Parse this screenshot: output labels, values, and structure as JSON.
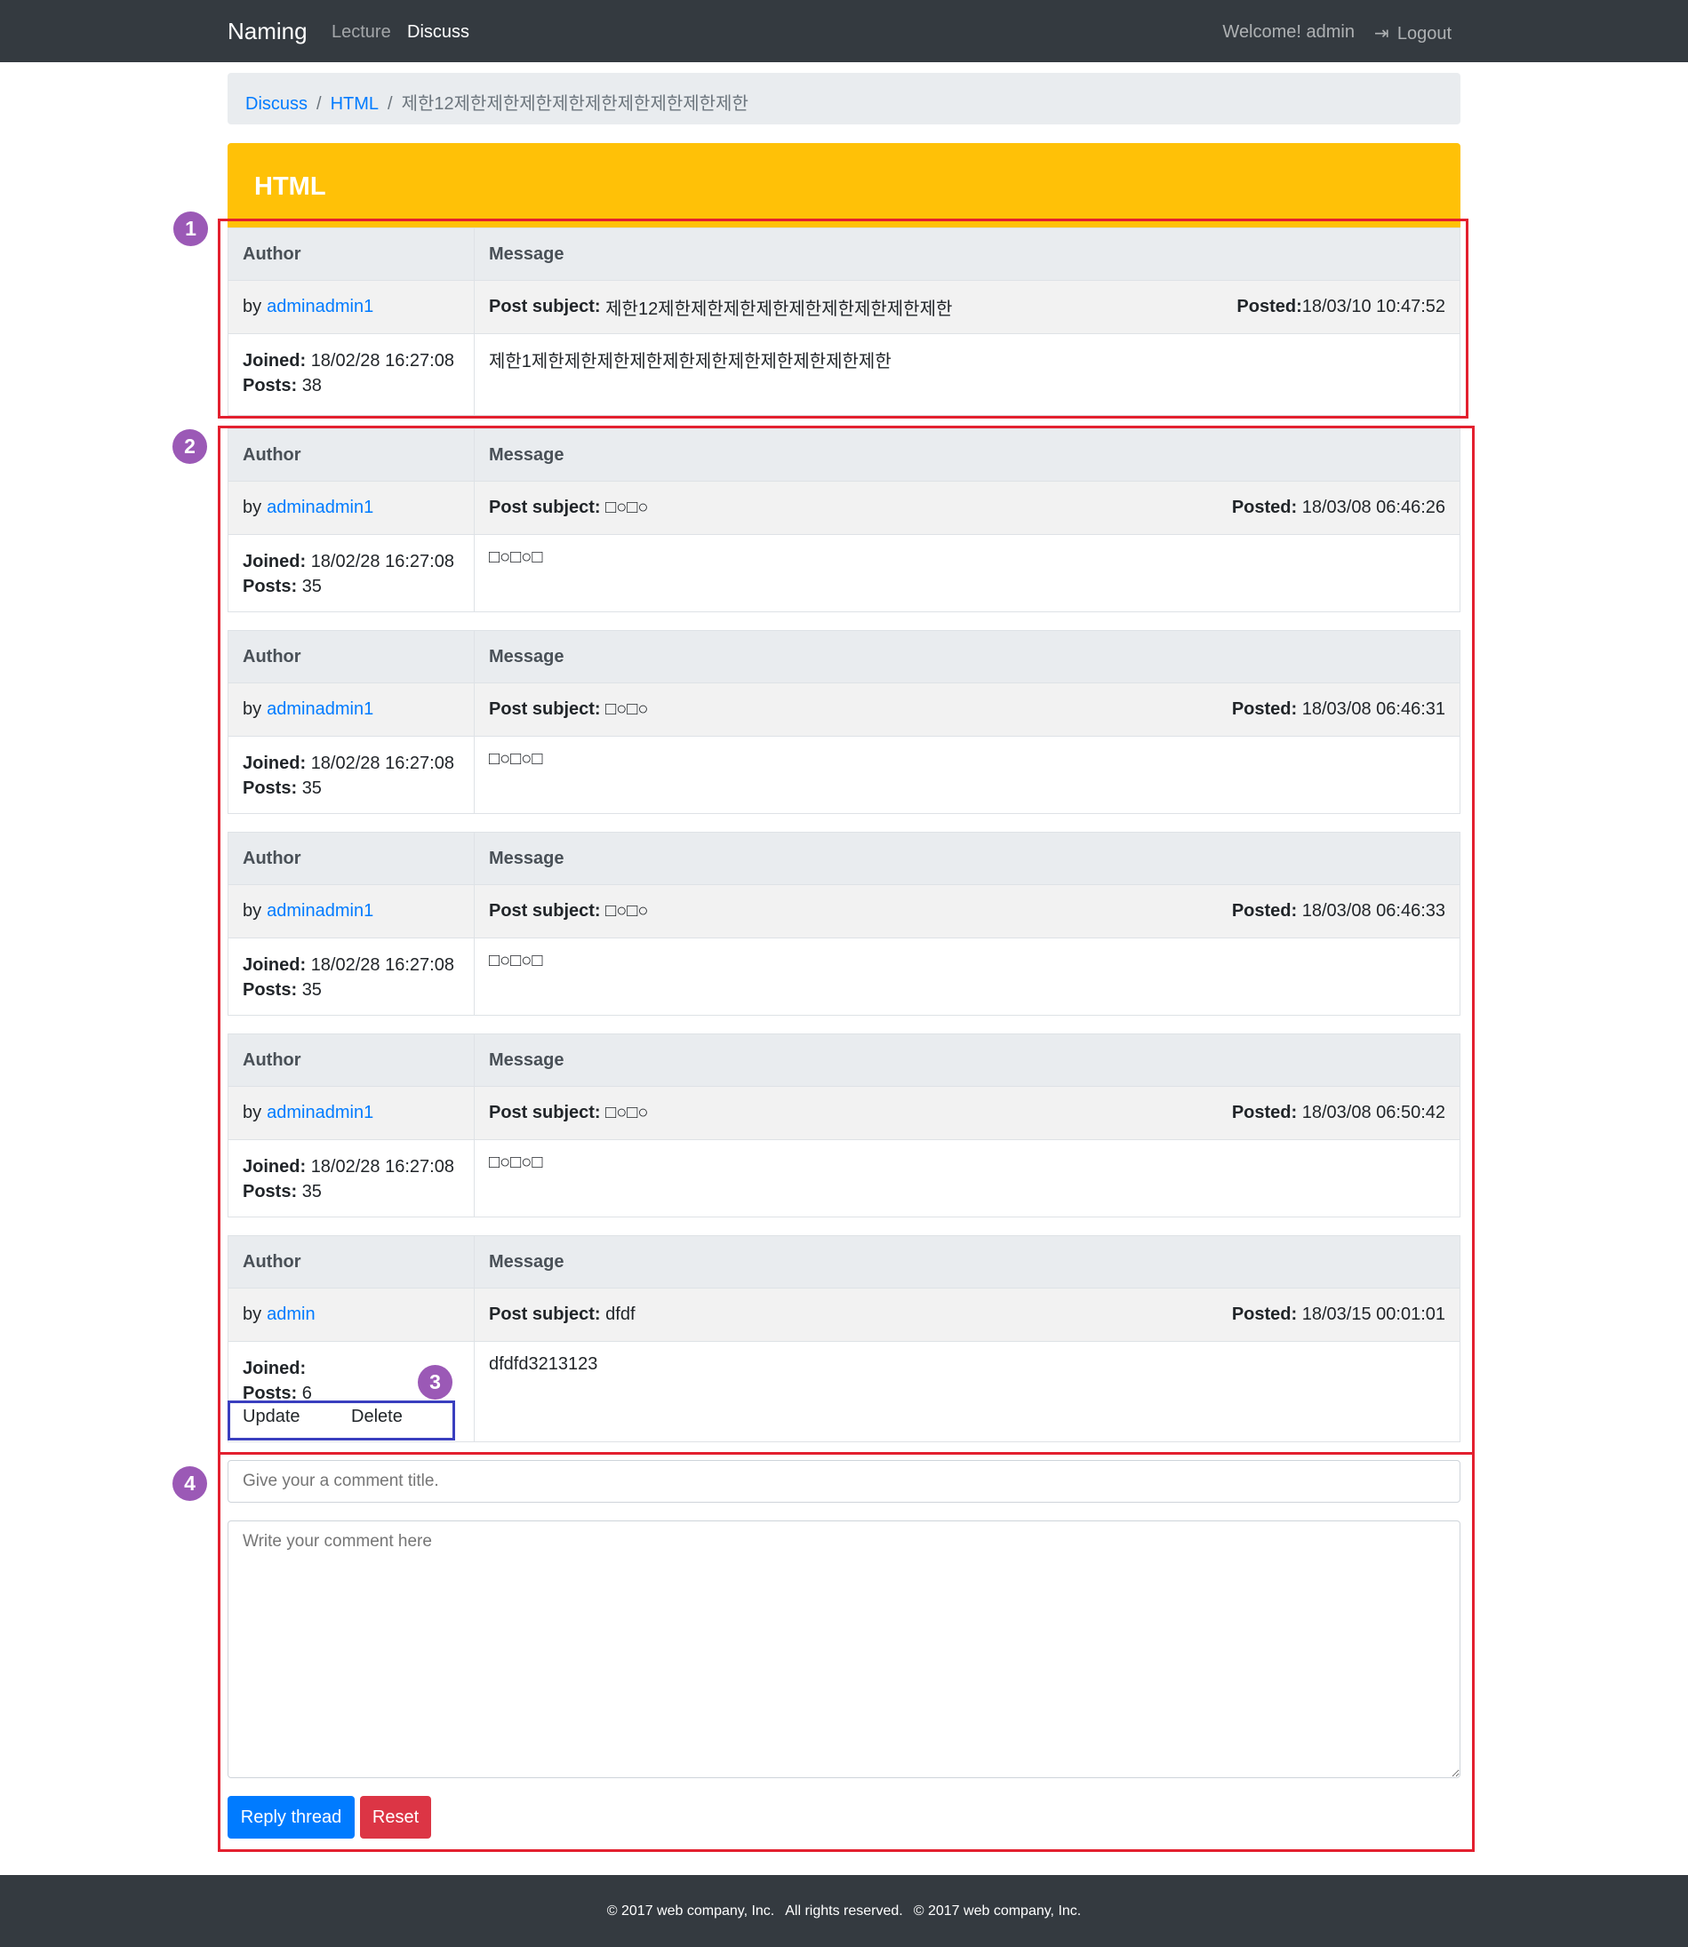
{
  "nav": {
    "brand": "Naming",
    "links": [
      "Lecture",
      "Discuss"
    ],
    "welcome": "Welcome! admin",
    "logout": "Logout"
  },
  "breadcrumb": {
    "items": [
      "Discuss",
      "HTML"
    ],
    "current": "제한12제한제한제한제한제한제한제한제한제한"
  },
  "card_title": "HTML",
  "labels": {
    "author": "Author",
    "message": "Message",
    "by": "by",
    "post_subject": "Post subject:",
    "posted": "Posted:",
    "joined": "Joined:",
    "posts": "Posts:",
    "update": "Update",
    "delete": "Delete"
  },
  "posts": [
    {
      "author": "adminadmin1",
      "subject": "제한12제한제한제한제한제한제한제한제한제한",
      "posted": "18/03/10 10:47:52",
      "joined": "18/02/28 16:27:08",
      "post_count": "38",
      "message": "제한1제한제한제한제한제한제한제한제한제한제한제한"
    },
    {
      "author": "adminadmin1",
      "subject": "□○□○",
      "posted": "18/03/08 06:46:26",
      "joined": "18/02/28 16:27:08",
      "post_count": "35",
      "message": "□○□○□"
    },
    {
      "author": "adminadmin1",
      "subject": "□○□○",
      "posted": "18/03/08 06:46:31",
      "joined": "18/02/28 16:27:08",
      "post_count": "35",
      "message": "□○□○□"
    },
    {
      "author": "adminadmin1",
      "subject": "□○□○",
      "posted": "18/03/08 06:46:33",
      "joined": "18/02/28 16:27:08",
      "post_count": "35",
      "message": "□○□○□"
    },
    {
      "author": "adminadmin1",
      "subject": "□○□○",
      "posted": "18/03/08 06:50:42",
      "joined": "18/02/28 16:27:08",
      "post_count": "35",
      "message": "□○□○□"
    },
    {
      "author": "admin",
      "subject": "dfdf",
      "posted": "18/03/15 00:01:01",
      "joined": "",
      "post_count": "6",
      "message": "dfdfd3213123"
    }
  ],
  "form": {
    "title_placeholder": "Give your a comment title.",
    "comment_placeholder": "Write your comment here",
    "reply_button": "Reply thread",
    "reset_button": "Reset"
  },
  "footer": {
    "parts": [
      "© 2017 web company, Inc.",
      "All rights reserved.",
      "© 2017 web company, Inc."
    ]
  },
  "annotations": [
    "1",
    "2",
    "3",
    "4"
  ],
  "colors": {
    "navbar": "#343a40",
    "header": "#ffc107",
    "link": "#007bff",
    "primary": "#007bff",
    "danger": "#dc3545",
    "annotation_red": "#e3202f",
    "annotation_blue": "#3a3fbf",
    "annotation_badge": "#9b59b6"
  }
}
